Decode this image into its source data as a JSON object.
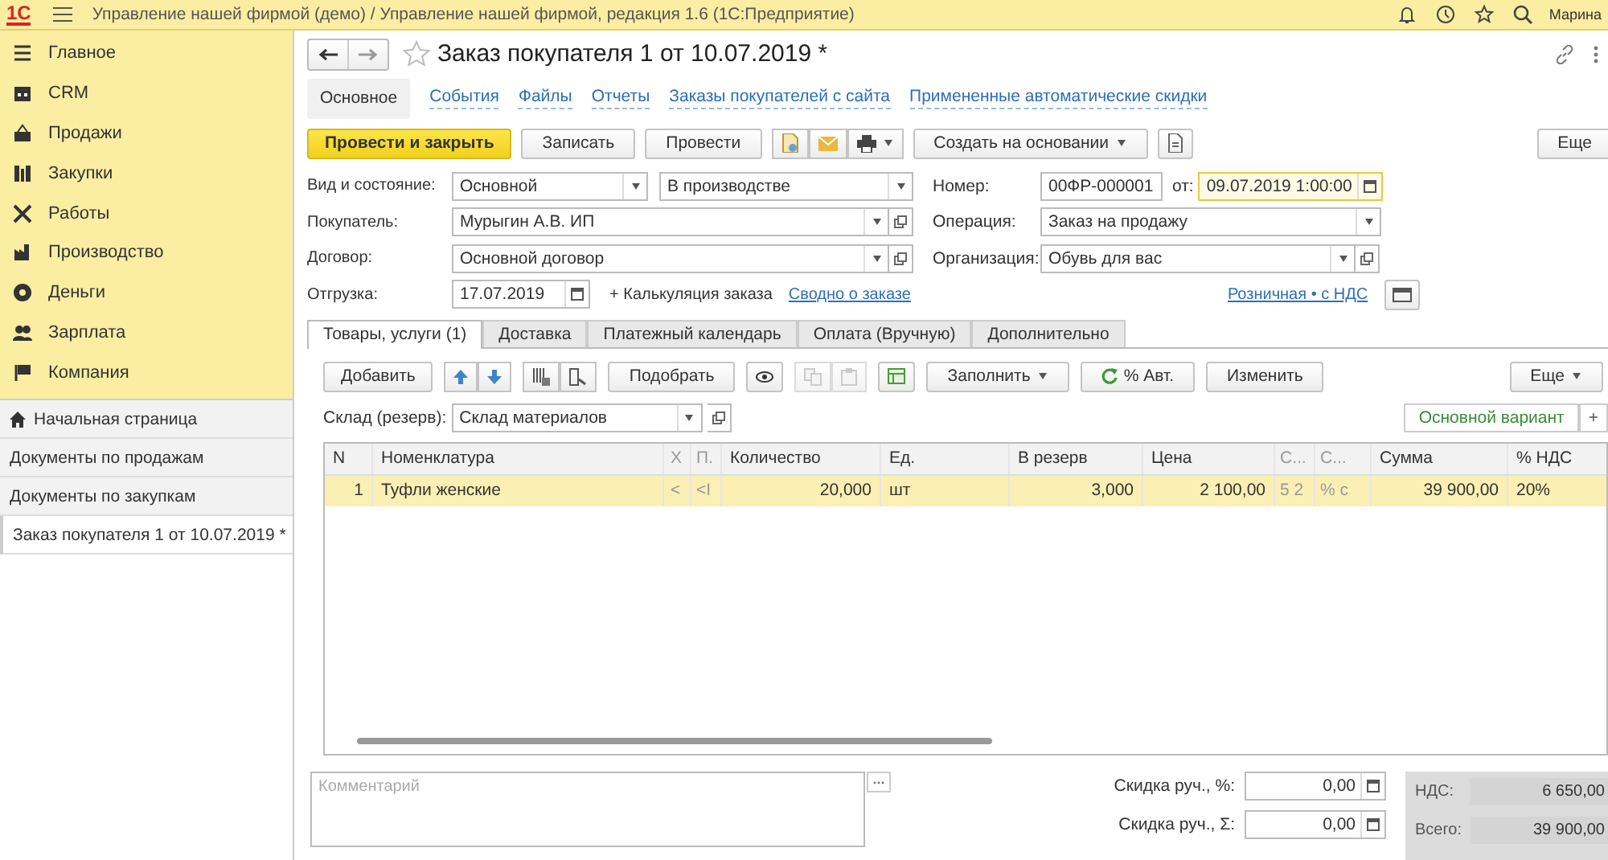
{
  "topbar": {
    "logo": "1С",
    "title": "Управление нашей фирмой (демо) / Управление нашей фирмой, редакция 1.6  (1С:Предприятие)",
    "user": "Марина"
  },
  "sections": [
    {
      "label": "Главное"
    },
    {
      "label": "CRM"
    },
    {
      "label": "Продажи"
    },
    {
      "label": "Закупки"
    },
    {
      "label": "Работы"
    },
    {
      "label": "Производство"
    },
    {
      "label": "Деньги"
    },
    {
      "label": "Зарплата"
    },
    {
      "label": "Компания"
    }
  ],
  "open_windows": [
    {
      "label": "Начальная страница",
      "kind": "home",
      "selected": false
    },
    {
      "label": "Документы по продажам",
      "kind": "page",
      "selected": false
    },
    {
      "label": "Документы по закупкам",
      "kind": "page",
      "selected": false
    },
    {
      "label": "Заказ покупателя 1 от 10.07.2019 *",
      "kind": "page",
      "selected": true
    }
  ],
  "document": {
    "title": "Заказ покупателя 1 от 10.07.2019 *",
    "nav": [
      {
        "label": "Основное",
        "selected": true
      },
      {
        "label": "События",
        "selected": false
      },
      {
        "label": "Файлы",
        "selected": false
      },
      {
        "label": "Отчеты",
        "selected": false
      },
      {
        "label": "Заказы покупателей с сайта",
        "selected": false
      },
      {
        "label": "Примененные автоматические скидки",
        "selected": false
      }
    ],
    "toolbar": [
      {
        "kind": "primary",
        "label": "Провести и закрыть"
      },
      {
        "kind": "button",
        "label": "Записать"
      },
      {
        "kind": "button",
        "label": "Провести"
      },
      {
        "kind": "icon-group"
      },
      {
        "kind": "menu",
        "label": "Создать на основании"
      },
      {
        "kind": "icon"
      },
      {
        "kind": "more",
        "label": "Еще"
      }
    ],
    "kind_state": {
      "label": "Вид и состояние:",
      "kind": "Основной",
      "state": "В производстве"
    },
    "number": {
      "label": "Номер:",
      "value": "00ФР-000001",
      "date_label": "от:",
      "date": "09.07.2019  1:00:00"
    },
    "customer": {
      "label": "Покупатель:",
      "value": "Мурыгин А.В. ИП"
    },
    "operation": {
      "label": "Операция:",
      "value": "Заказ на продажу"
    },
    "contract": {
      "label": "Договор:",
      "value": "Основной договор"
    },
    "organization": {
      "label": "Организация:",
      "value": "Обувь для вас"
    },
    "shipment": {
      "label": "Отгрузка:",
      "value": "17.07.2019"
    },
    "calc_link": "+ Калькуляция заказа",
    "summary_link": "Сводно о заказе",
    "price_link": "Розничная • с НДС",
    "tabs": [
      {
        "label": "Товары, услуги (1)",
        "selected": true
      },
      {
        "label": "Доставка",
        "selected": false
      },
      {
        "label": "Платежный календарь",
        "selected": false
      },
      {
        "label": "Оплата (Вручную)",
        "selected": false
      },
      {
        "label": "Дополнительно",
        "selected": false
      }
    ],
    "table_toolbar": [
      {
        "kind": "button",
        "label": "Добавить"
      },
      {
        "kind": "updown"
      },
      {
        "kind": "icon-pair"
      },
      {
        "kind": "button",
        "label": "Подобрать"
      },
      {
        "kind": "eye"
      },
      {
        "kind": "copy-pair"
      },
      {
        "kind": "sheet"
      },
      {
        "kind": "menu",
        "label": "Заполнить"
      },
      {
        "kind": "refresh",
        "label": "% Авт."
      },
      {
        "kind": "button",
        "label": "Изменить"
      },
      {
        "kind": "more",
        "label": "Еще"
      }
    ],
    "warehouse": {
      "label": "Склад (резерв):",
      "value": "Склад материалов"
    },
    "variant": "Основной вариант",
    "add_variant": "+",
    "table": {
      "columns": [
        "N",
        "Номенклатура",
        "Х",
        "П.",
        "Количество",
        "Ед.",
        "В резерв",
        "Цена",
        "С...",
        "С...",
        "Сумма",
        "% НДС"
      ],
      "rows": [
        {
          "selected": true,
          "cells": [
            "1",
            "Туфли женские",
            "<",
            "<I",
            "20,000",
            "шт",
            "3,000",
            "2 100,00",
            "5  2",
            "%  с",
            "39 900,00",
            "20%"
          ]
        }
      ]
    },
    "comment": {
      "placeholder": "Комментарий"
    },
    "discounts": [
      {
        "label": "Скидка руч., %:",
        "value": "0,00"
      },
      {
        "label": "Скидка руч., Σ:",
        "value": "0,00"
      }
    ],
    "totals": [
      {
        "label": "НДС:",
        "value": "6 650,00"
      },
      {
        "label": "Всего:",
        "value": "39 900,00"
      }
    ]
  }
}
